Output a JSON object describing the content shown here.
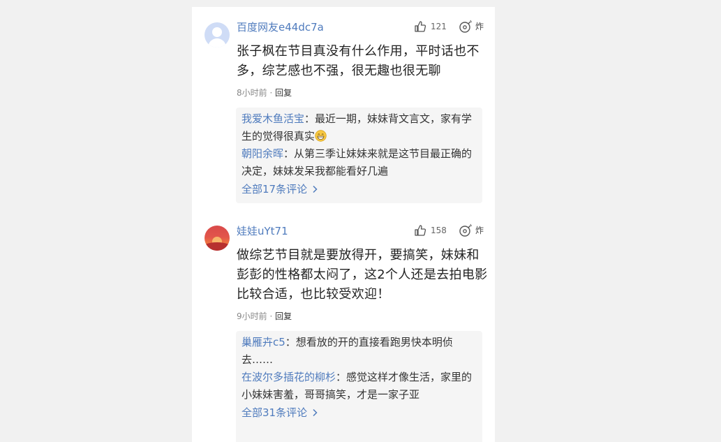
{
  "comments": [
    {
      "username": "百度网友e44dc7a",
      "like_count": "121",
      "bomb_label": "炸",
      "content": "张子枫在节目真没有什么作用，平时话也不多，综艺感也不强，很无趣也很无聊",
      "time": "8小时前",
      "separator": "·",
      "reply_label": "回复",
      "replies": [
        {
          "user": "我爱木鱼活宝",
          "colon": "：",
          "text": "最近一期，妹妹背文言文，家有学生的觉得很真实",
          "emoji": "grinning-face-icon"
        },
        {
          "user": "朝阳余晖",
          "colon": "：",
          "text": "从第三季让妹妹来就是这节目最正确的决定，妹妹发呆我都能看好几遍"
        }
      ],
      "view_all": "全部17条评论"
    },
    {
      "username": "娃娃uYt71",
      "like_count": "158",
      "bomb_label": "炸",
      "content": "做综艺节目就是要放得开，要搞笑，妹妹和彭彭的性格都太闷了，这2个人还是去拍电影比较合适，也比较受欢迎！",
      "time": "9小时前",
      "separator": "·",
      "reply_label": "回复",
      "replies": [
        {
          "user": "巢雁卉c5",
          "colon": "：",
          "text": "想看放的开的直接看跑男快本明侦去……"
        },
        {
          "user": "在波尔多插花的柳杉",
          "colon": "：",
          "text": "感觉这样才像生活，家里的小妹妹害羞，哥哥搞笑，才是一家子亚"
        }
      ],
      "view_all": "全部31条评论"
    }
  ],
  "colors": {
    "link": "#4f7bbd",
    "text": "#222222",
    "meta": "#888888",
    "reply_bg": "#f5f5f5",
    "page_bg": "#f1f1f1"
  },
  "icons": {
    "like": "thumbs-up-icon",
    "bomb": "bomb-icon",
    "chevron": "chevron-right-icon"
  }
}
